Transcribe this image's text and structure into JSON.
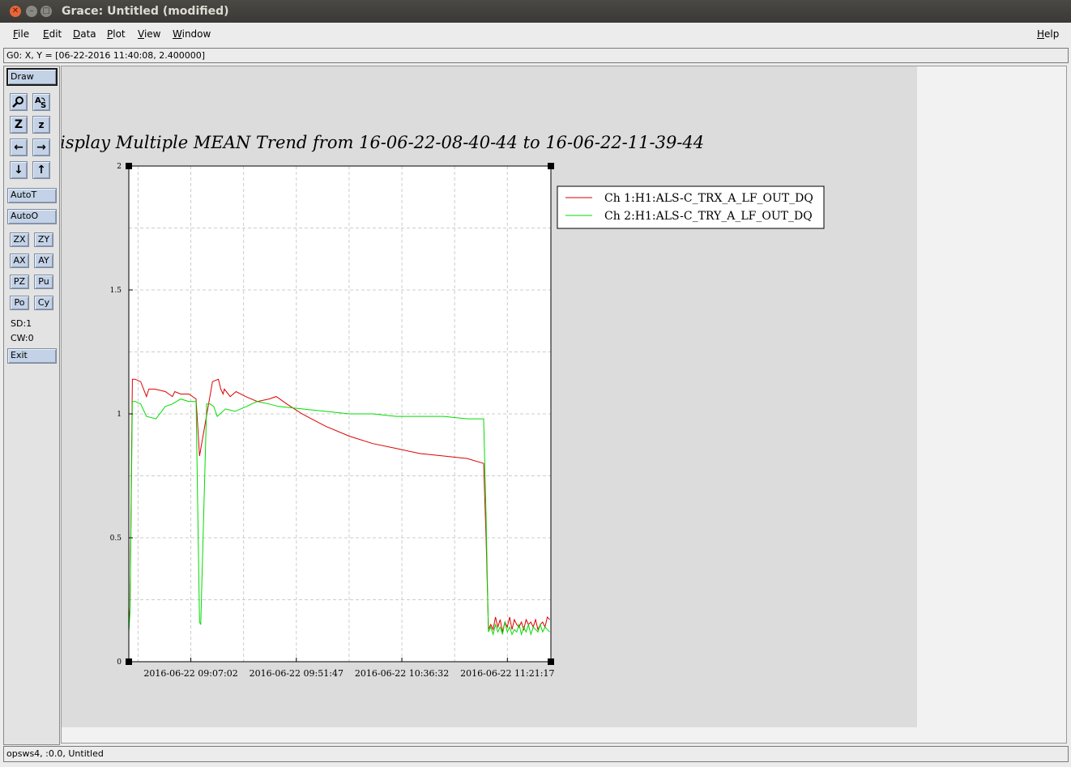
{
  "window": {
    "title": "Grace: Untitled (modified)"
  },
  "menubar": {
    "items": [
      {
        "label": "File",
        "key": "F",
        "rest": "ile"
      },
      {
        "label": "Edit",
        "key": "E",
        "rest": "dit"
      },
      {
        "label": "Data",
        "key": "D",
        "rest": "ata"
      },
      {
        "label": "Plot",
        "key": "P",
        "rest": "lot"
      },
      {
        "label": "View",
        "key": "V",
        "rest": "iew"
      },
      {
        "label": "Window",
        "key": "W",
        "rest": "indow"
      }
    ],
    "help": {
      "label": "Help",
      "key": "H",
      "rest": "elp"
    }
  },
  "locator": {
    "text": "G0: X, Y = [06-22-2016 11:40:08, 2.400000]"
  },
  "toolbar": {
    "draw": "Draw",
    "autot": "AutoT",
    "autoo": "AutoO",
    "zx": "ZX",
    "zy": "ZY",
    "ax": "AX",
    "ay": "AY",
    "pz": "PZ",
    "pu": "Pu",
    "po": "Po",
    "cy": "Cy",
    "sd": "SD:1",
    "cw": "CW:0",
    "exit": "Exit",
    "icons": [
      "zoom-icon",
      "text-icon",
      "autoscale-z-icon",
      "zoom-z-icon",
      "left-arrow-icon",
      "right-arrow-icon",
      "down-arrow-icon",
      "up-arrow-icon"
    ]
  },
  "status": {
    "text": "opsws4, :0.0, Untitled"
  },
  "colors": {
    "series1": "#dd0000",
    "series2": "#00dd00",
    "titlebar": "#3c3b37"
  },
  "chart_data": {
    "type": "line",
    "title": "isplay Multiple MEAN Trend from 16-06-22-08-40-44 to 16-06-22-11-39-44",
    "xlabel": "",
    "ylabel": "",
    "ylim": [
      0,
      2
    ],
    "xlim": [
      "2016-06-22 08:40:44",
      "2016-06-22 11:39:44"
    ],
    "yticks": [
      "0",
      "0.5",
      "1",
      "1.5",
      "2"
    ],
    "xticks": [
      "2016-06-22 09:07:02",
      "2016-06-22 09:51:47",
      "2016-06-22 10:36:32",
      "2016-06-22 11:21:17"
    ],
    "grid": true,
    "legend_position": "right",
    "series": [
      {
        "name": "Ch 1:H1:ALS-C_TRX_A_LF_OUT_DQ",
        "color": "#dd0000",
        "x": [
          "2016-06-22 08:40:44",
          "2016-06-22 08:41:14",
          "2016-06-22 08:42:14",
          "2016-06-22 08:43:24",
          "2016-06-22 08:45:44",
          "2016-06-22 08:48:14",
          "2016-06-22 08:49:14",
          "2016-06-22 08:51:44",
          "2016-06-22 08:56:14",
          "2016-06-22 08:59:14",
          "2016-06-22 09:00:14",
          "2016-06-22 09:02:44",
          "2016-06-22 09:06:14",
          "2016-06-22 09:09:14",
          "2016-06-22 09:10:44",
          "2016-06-22 09:16:14",
          "2016-06-22 09:18:44",
          "2016-06-22 09:19:14",
          "2016-06-22 09:19:44",
          "2016-06-22 09:20:44",
          "2016-06-22 09:21:14",
          "2016-06-22 09:23:44",
          "2016-06-22 09:26:14",
          "2016-06-22 09:30:14",
          "2016-06-22 09:35:14",
          "2016-06-22 09:40:14",
          "2016-06-22 09:43:14",
          "2016-06-22 09:44:44",
          "2016-06-22 09:47:44",
          "2016-06-22 09:54:14",
          "2016-06-22 10:04:14",
          "2016-06-22 10:14:14",
          "2016-06-22 10:24:14",
          "2016-06-22 10:34:14",
          "2016-06-22 10:44:14",
          "2016-06-22 10:54:14",
          "2016-06-22 11:04:14",
          "2016-06-22 11:11:14",
          "2016-06-22 11:12:14",
          "2016-06-22 11:13:14",
          "2016-06-22 11:14:14",
          "2016-06-22 11:15:14",
          "2016-06-22 11:16:14",
          "2016-06-22 11:17:14",
          "2016-06-22 11:18:14",
          "2016-06-22 11:19:14",
          "2016-06-22 11:20:14",
          "2016-06-22 11:21:14",
          "2016-06-22 11:22:14",
          "2016-06-22 11:23:14",
          "2016-06-22 11:24:14",
          "2016-06-22 11:25:14",
          "2016-06-22 11:26:14",
          "2016-06-22 11:27:14",
          "2016-06-22 11:28:14",
          "2016-06-22 11:29:14",
          "2016-06-22 11:30:14",
          "2016-06-22 11:31:14",
          "2016-06-22 11:32:14",
          "2016-06-22 11:33:14",
          "2016-06-22 11:34:14",
          "2016-06-22 11:35:14",
          "2016-06-22 11:36:14",
          "2016-06-22 11:37:14",
          "2016-06-22 11:38:14",
          "2016-06-22 11:39:14"
        ],
        "values": [
          0.13,
          0.22,
          1.14,
          1.14,
          1.13,
          1.07,
          1.1,
          1.1,
          1.09,
          1.07,
          1.09,
          1.08,
          1.08,
          1.06,
          0.83,
          1.13,
          1.14,
          1.12,
          1.1,
          1.08,
          1.1,
          1.07,
          1.09,
          1.07,
          1.05,
          1.06,
          1.07,
          1.06,
          1.04,
          1.0,
          0.95,
          0.91,
          0.88,
          0.86,
          0.84,
          0.83,
          0.82,
          0.8,
          0.5,
          0.13,
          0.15,
          0.13,
          0.18,
          0.14,
          0.17,
          0.12,
          0.16,
          0.14,
          0.18,
          0.13,
          0.17,
          0.15,
          0.14,
          0.16,
          0.13,
          0.17,
          0.15,
          0.16,
          0.14,
          0.17,
          0.13,
          0.15,
          0.16,
          0.14,
          0.18,
          0.17
        ]
      },
      {
        "name": "Ch 2:H1:ALS-C_TRY_A_LF_OUT_DQ",
        "color": "#00dd00",
        "x": [
          "2016-06-22 08:40:44",
          "2016-06-22 08:41:14",
          "2016-06-22 08:42:14",
          "2016-06-22 08:43:24",
          "2016-06-22 08:45:44",
          "2016-06-22 08:48:14",
          "2016-06-22 08:52:14",
          "2016-06-22 08:56:14",
          "2016-06-22 08:59:14",
          "2016-06-22 09:02:44",
          "2016-06-22 09:06:14",
          "2016-06-22 09:09:14",
          "2016-06-22 09:10:44",
          "2016-06-22 09:11:14",
          "2016-06-22 09:13:44",
          "2016-06-22 09:15:14",
          "2016-06-22 09:16:44",
          "2016-06-22 09:18:14",
          "2016-06-22 09:21:44",
          "2016-06-22 09:25:44",
          "2016-06-22 09:30:44",
          "2016-06-22 09:32:44",
          "2016-06-22 09:35:14",
          "2016-06-22 09:40:14",
          "2016-06-22 09:44:14",
          "2016-06-22 09:54:14",
          "2016-06-22 10:04:14",
          "2016-06-22 10:14:14",
          "2016-06-22 10:24:14",
          "2016-06-22 10:34:14",
          "2016-06-22 10:44:14",
          "2016-06-22 10:54:14",
          "2016-06-22 11:04:14",
          "2016-06-22 11:11:14",
          "2016-06-22 11:12:14",
          "2016-06-22 11:13:14",
          "2016-06-22 11:14:14",
          "2016-06-22 11:15:14",
          "2016-06-22 11:16:14",
          "2016-06-22 11:17:14",
          "2016-06-22 11:18:14",
          "2016-06-22 11:19:14",
          "2016-06-22 11:20:14",
          "2016-06-22 11:21:14",
          "2016-06-22 11:22:14",
          "2016-06-22 11:23:14",
          "2016-06-22 11:24:14",
          "2016-06-22 11:25:14",
          "2016-06-22 11:26:14",
          "2016-06-22 11:27:14",
          "2016-06-22 11:28:14",
          "2016-06-22 11:29:14",
          "2016-06-22 11:30:14",
          "2016-06-22 11:31:14",
          "2016-06-22 11:32:14",
          "2016-06-22 11:33:14",
          "2016-06-22 11:34:14",
          "2016-06-22 11:35:14",
          "2016-06-22 11:36:14",
          "2016-06-22 11:37:14",
          "2016-06-22 11:38:14",
          "2016-06-22 11:39:14"
        ],
        "values": [
          0.12,
          0.2,
          1.05,
          1.05,
          1.04,
          0.99,
          0.98,
          1.03,
          1.04,
          1.06,
          1.05,
          1.05,
          0.16,
          0.15,
          1.04,
          1.04,
          1.03,
          0.99,
          1.02,
          1.01,
          1.03,
          1.04,
          1.05,
          1.04,
          1.03,
          1.02,
          1.01,
          1.0,
          1.0,
          0.99,
          0.99,
          0.99,
          0.98,
          0.98,
          0.59,
          0.12,
          0.14,
          0.11,
          0.15,
          0.12,
          0.14,
          0.11,
          0.16,
          0.12,
          0.14,
          0.11,
          0.13,
          0.12,
          0.15,
          0.11,
          0.14,
          0.12,
          0.15,
          0.11,
          0.14,
          0.13,
          0.12,
          0.15,
          0.12,
          0.14,
          0.13,
          0.12
        ]
      }
    ]
  }
}
